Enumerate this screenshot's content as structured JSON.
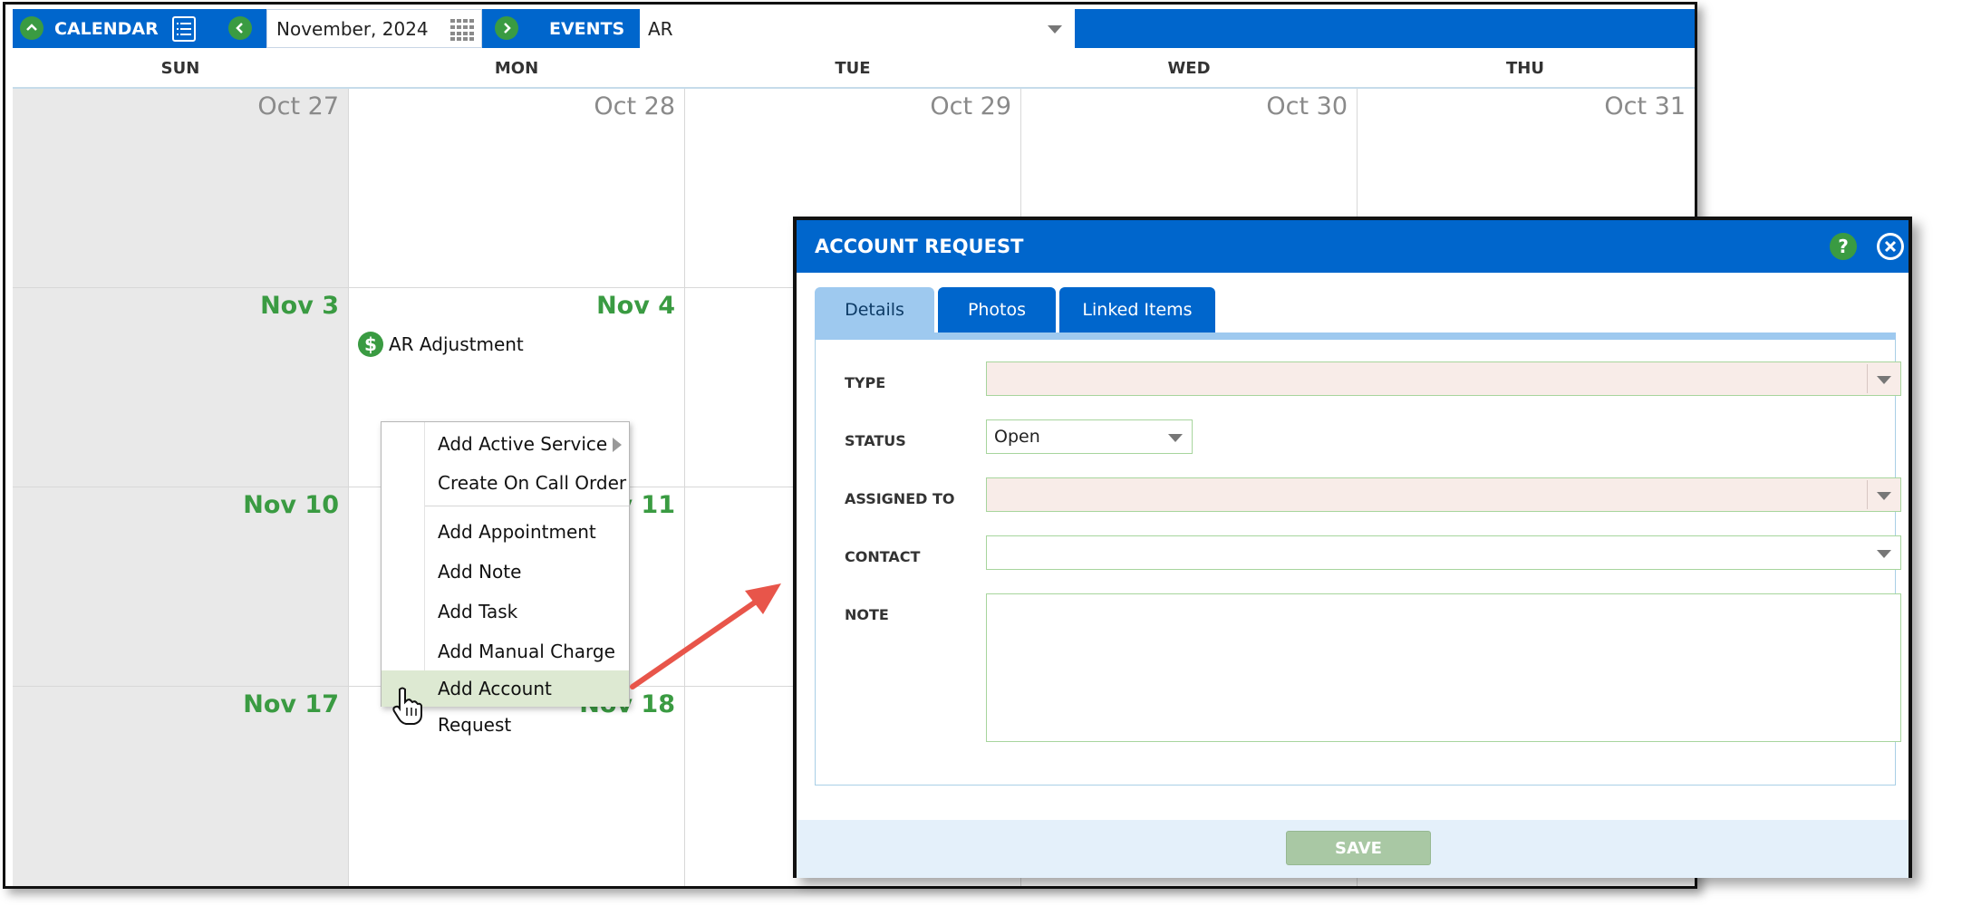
{
  "topbar": {
    "calendar_label": "CALENDAR",
    "month_value": "November, 2024",
    "events_label": "EVENTS",
    "filter_value": "AR"
  },
  "day_headers": [
    "SUN",
    "MON",
    "TUE",
    "WED",
    "THU"
  ],
  "weeks": [
    [
      "Oct 27",
      "Oct 28",
      "Oct 29",
      "Oct 30",
      "Oct 31"
    ],
    [
      "Nov 3",
      "Nov 4",
      "",
      "",
      ""
    ],
    [
      "Nov 10",
      "Nov 11",
      "",
      "",
      ""
    ],
    [
      "Nov 17",
      "Nov 18",
      "",
      "",
      ""
    ]
  ],
  "events": {
    "nov4": {
      "label": "AR Adjustment",
      "icon": "dollar-icon"
    }
  },
  "context_menu": {
    "items": [
      "Add Active Service",
      "Create On Call Order",
      "Add Appointment",
      "Add Note",
      "Add Task",
      "Add Manual Charge",
      "Add Account Request"
    ],
    "highlighted": "Add Account Request"
  },
  "dialog": {
    "title": "ACCOUNT REQUEST",
    "help_label": "?",
    "tabs": [
      "Details",
      "Photos",
      "Linked Items"
    ],
    "active_tab": "Details",
    "fields": {
      "type_label": "TYPE",
      "type_value": "",
      "status_label": "STATUS",
      "status_value": "Open",
      "assigned_label": "ASSIGNED TO",
      "assigned_value": "",
      "contact_label": "CONTACT",
      "contact_value": "",
      "note_label": "NOTE",
      "note_value": ""
    },
    "save_label": "SAVE"
  },
  "colors": {
    "brand_blue": "#0066cc",
    "accent_green": "#3a9b42",
    "highlight": "#dde9d2",
    "required_bg": "#f8ece8",
    "arrow_red": "#e8554a"
  }
}
